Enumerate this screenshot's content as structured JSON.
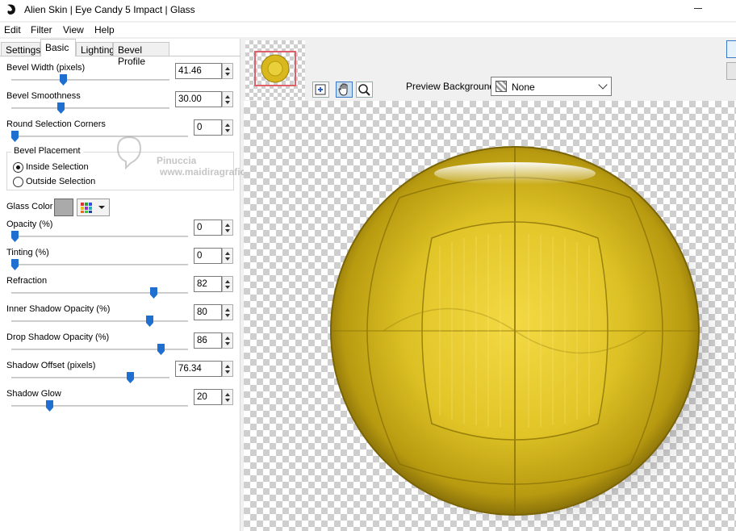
{
  "window": {
    "title": "Alien Skin | Eye Candy 5 Impact | Glass"
  },
  "menu": [
    "Edit",
    "Filter",
    "View",
    "Help"
  ],
  "tabs": [
    {
      "label": "Settings",
      "active": false
    },
    {
      "label": "Basic",
      "active": true
    },
    {
      "label": "Lighting",
      "active": false
    },
    {
      "label": "Bevel Profile",
      "active": false
    }
  ],
  "controls": {
    "bevel_width": {
      "label": "Bevel Width (pixels)",
      "value": "41.46"
    },
    "bevel_smoothness": {
      "label": "Bevel Smoothness",
      "value": "30.00"
    },
    "round_corners": {
      "label": "Round Selection Corners",
      "value": "0"
    },
    "opacity": {
      "label": "Opacity (%)",
      "value": "0"
    },
    "tinting": {
      "label": "Tinting (%)",
      "value": "0"
    },
    "refraction": {
      "label": "Refraction",
      "value": "82"
    },
    "inner_shadow": {
      "label": "Inner Shadow Opacity (%)",
      "value": "80"
    },
    "drop_shadow": {
      "label": "Drop Shadow Opacity (%)",
      "value": "86"
    },
    "shadow_offset": {
      "label": "Shadow Offset (pixels)",
      "value": "76.34"
    },
    "shadow_glow": {
      "label": "Shadow Glow",
      "value": "20"
    }
  },
  "bevel_placement": {
    "title": "Bevel Placement",
    "options": [
      {
        "label": "Inside Selection",
        "selected": true
      },
      {
        "label": "Outside Selection",
        "selected": false
      }
    ]
  },
  "glass_color": {
    "label": "Glass Color",
    "color": "#aaaaaa"
  },
  "preview": {
    "background_label": "Preview Background:",
    "background_value": "None"
  },
  "watermark": {
    "line1": "Pinuccia",
    "line2": "www.maidiragrafica.eu"
  },
  "colors": {
    "accent": "#1e6fd0",
    "sphere": "#d8b81c"
  }
}
